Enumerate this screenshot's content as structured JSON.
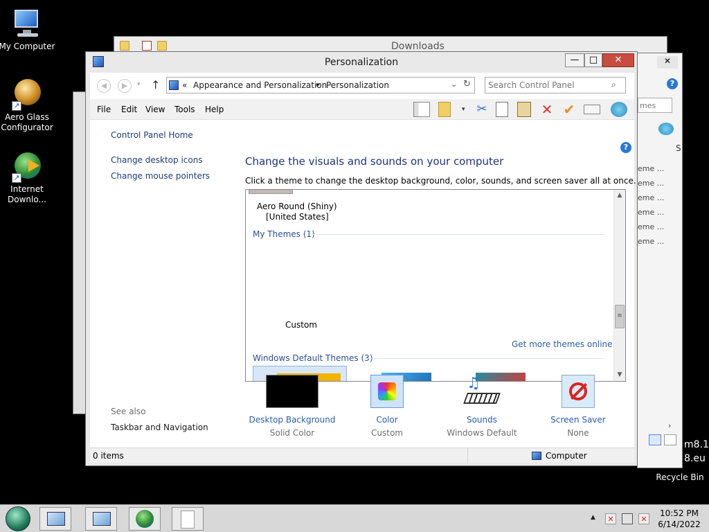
{
  "desktop": {
    "icons": [
      {
        "label": "My Computer",
        "icon": "computer-icon"
      },
      {
        "label": "Aero Glass Configurator",
        "icon": "aero-glass-icon"
      },
      {
        "label": "Internet Downlo...",
        "icon": "idm-icon"
      },
      {
        "label": "Recycle Bin",
        "icon": "recycle-bin-icon"
      }
    ],
    "watermark_lines": [
      "m8.1",
      "8.eu"
    ]
  },
  "background_window": {
    "title": "Downloads",
    "search_placeholder": "mes",
    "items": [
      "eme ...",
      "eme ...",
      "eme ...",
      "eme ...",
      "eme ...",
      "eme ..."
    ],
    "column_letter": "S"
  },
  "window": {
    "title": "Personalization",
    "controls": {
      "minimize": "—",
      "maximize": "□",
      "close": "✕"
    },
    "address": {
      "prefix": "«",
      "crumbs": [
        "Appearance and Personalization",
        "Personalization"
      ],
      "separator": "▸"
    },
    "search": {
      "placeholder": "Search Control Panel"
    },
    "menu": [
      "File",
      "Edit",
      "View",
      "Tools",
      "Help"
    ],
    "toolbar_icons": [
      "pane-icon",
      "properties-icon",
      "cut-icon",
      "copy-icon",
      "paste-icon",
      "delete-icon",
      "check-icon",
      "rename-icon",
      "shell-icon"
    ],
    "help_glyph": "?",
    "left_pane": {
      "home": "Control Panel Home",
      "links": [
        "Change desktop icons",
        "Change mouse pointers"
      ],
      "see_also_label": "See also",
      "see_also_links": [
        "Taskbar and Navigation"
      ]
    },
    "heading": "Change the visuals and sounds on your computer",
    "subtext": "Click a theme to change the desktop background, color, sounds, and screen saver all at once.",
    "theme_list": {
      "partial_theme": {
        "name": "Aero Round (Shiny)",
        "region": "[United States]"
      },
      "my_themes_header": "My Themes (1)",
      "custom_theme": "Custom",
      "get_more_link": "Get more themes online",
      "default_header": "Windows Default Themes (3)"
    },
    "bottom": [
      {
        "label": "Desktop Background",
        "value": "Solid Color"
      },
      {
        "label": "Color",
        "value": "Custom"
      },
      {
        "label": "Sounds",
        "value": "Windows Default"
      },
      {
        "label": "Screen Saver",
        "value": "None"
      }
    ],
    "status": {
      "items": "0 items",
      "location": "Computer"
    }
  },
  "taskbar": {
    "clock_time": "10:52 PM",
    "clock_date": "6/14/2022",
    "tray_arrow": "▲"
  }
}
